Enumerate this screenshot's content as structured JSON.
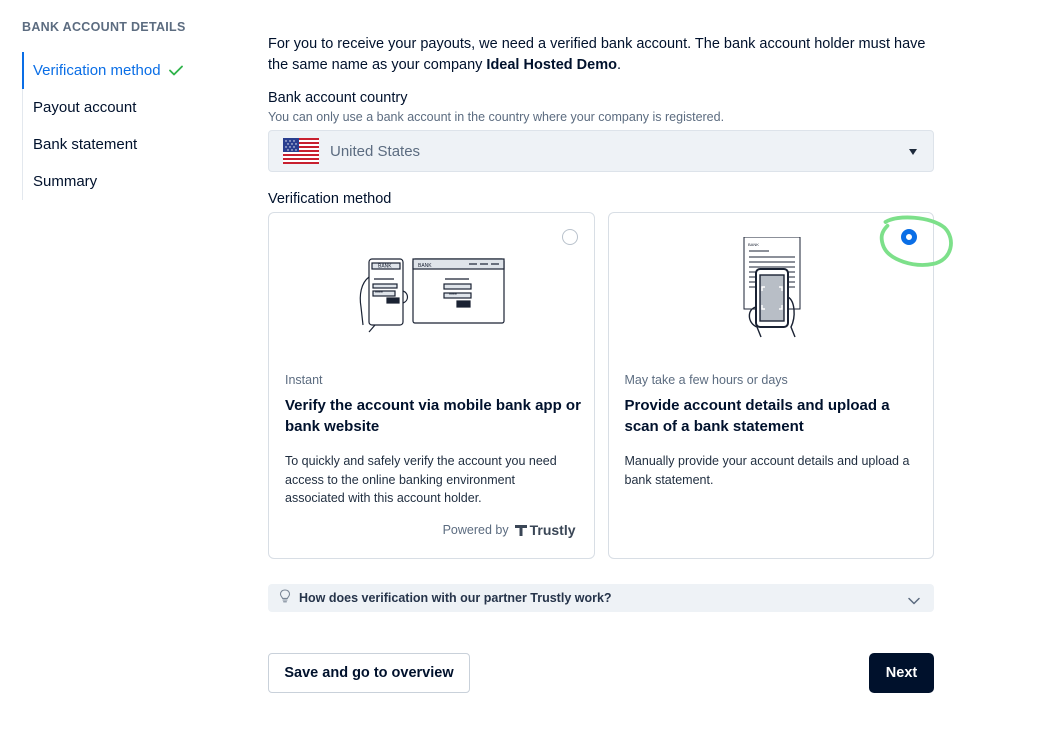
{
  "sidebar": {
    "title": "BANK ACCOUNT DETAILS",
    "steps": [
      {
        "label": "Verification method",
        "active": true,
        "completed": true
      },
      {
        "label": "Payout account",
        "active": false
      },
      {
        "label": "Bank statement",
        "active": false
      },
      {
        "label": "Summary",
        "active": false
      }
    ]
  },
  "intro": {
    "text": "For you to receive your payouts, we need a verified bank account. The bank account holder must have the same name as your company ",
    "company": "Ideal Hosted Demo",
    "suffix": "."
  },
  "country": {
    "label": "Bank account country",
    "hint": "You can only use a bank account in the country where your company is registered.",
    "value": "United States",
    "flag_icon": "us-flag-icon"
  },
  "verification": {
    "label": "Verification method",
    "options": [
      {
        "eyebrow": "Instant",
        "title": "Verify the account via mobile bank app or bank website",
        "description": "To quickly and safely verify the account you need access to the online banking environment associated with this account holder.",
        "powered_by": "Powered by",
        "provider": "Trustly",
        "selected": false,
        "icon": "bank-app-illustration"
      },
      {
        "eyebrow": "May take a few hours or days",
        "title": "Provide account details and upload a scan of a bank statement",
        "description": "Manually provide your account details and upload a bank statement.",
        "selected": true,
        "icon": "scan-statement-illustration"
      }
    ]
  },
  "faq": {
    "text": "How does verification with our partner Trustly work?",
    "icon": "lightbulb-icon"
  },
  "actions": {
    "secondary": "Save and go to overview",
    "primary": "Next"
  },
  "colors": {
    "accent": "#0a6ee6",
    "primary_button": "#00112c",
    "success": "#2fb34a",
    "annotation": "#7de08a"
  }
}
